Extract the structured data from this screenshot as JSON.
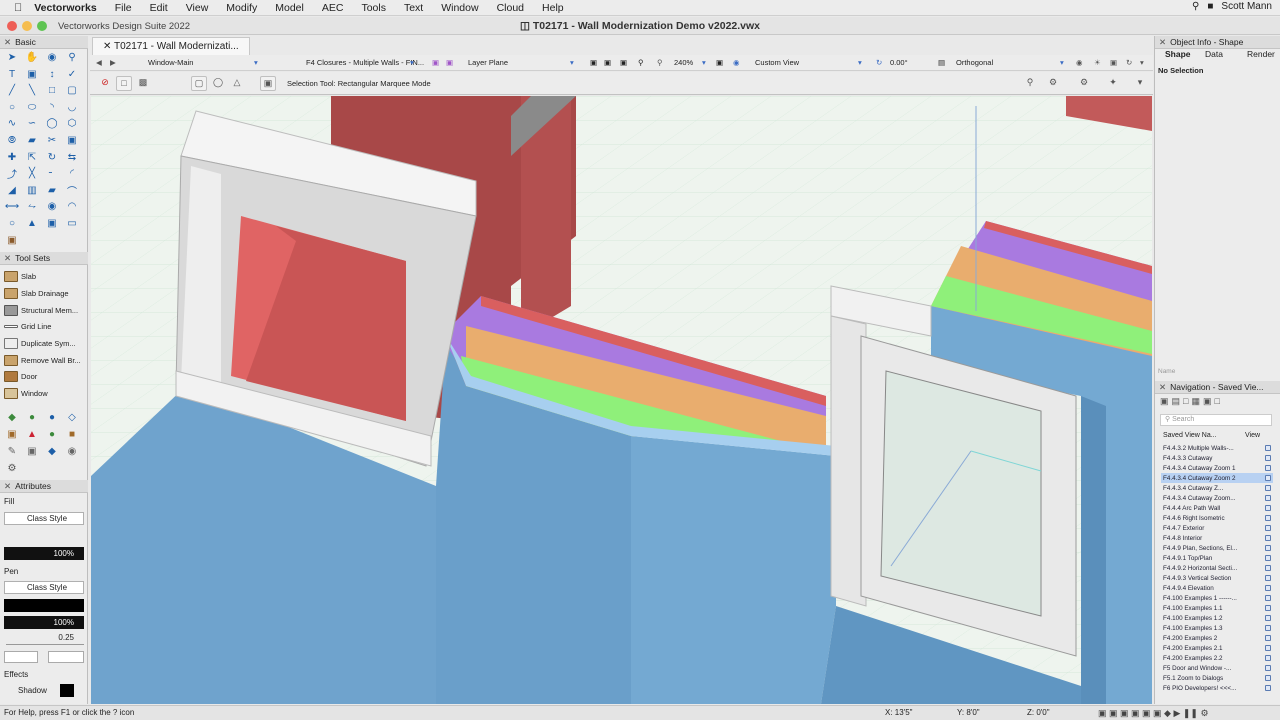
{
  "menubar": {
    "app": "Vectorworks",
    "items": [
      "File",
      "Edit",
      "View",
      "Modify",
      "Model",
      "AEC",
      "Tools",
      "Text",
      "Window",
      "Cloud",
      "Help"
    ],
    "user": "Scott Mann"
  },
  "titlebar": {
    "app_name": "Vectorworks Design Suite 2022",
    "document_title": "T02171 - Wall Modernization Demo v2022.vwx"
  },
  "doc_tab": {
    "label": "T02171 - Wall Modernizati..."
  },
  "view_bar": {
    "window": "Window-Main",
    "class": "F4 Closures - Multiple Walls - FIN...",
    "layer": "Layer Plane",
    "zoom": "240%",
    "view": "Custom View",
    "rotation": "0.00°",
    "projection": "Orthogonal"
  },
  "mode_bar": {
    "message": "Selection Tool: Rectangular Marquee Mode"
  },
  "palettes": {
    "basic": {
      "title": "Basic"
    },
    "tool_sets": {
      "title": "Tool Sets",
      "items": [
        "Slab",
        "Slab Drainage",
        "Structural Mem...",
        "Grid Line",
        "Duplicate Sym...",
        "Remove Wall Br...",
        "Door",
        "Window"
      ]
    },
    "attributes": {
      "title": "Attributes",
      "fill_label": "Fill",
      "fill_style": "Class Style",
      "fill_opacity": "100%",
      "pen_label": "Pen",
      "pen_style": "Class Style",
      "pen_opacity": "100%",
      "line_weight": "0.25",
      "effects_label": "Effects",
      "shadow_label": "Shadow"
    }
  },
  "object_info": {
    "title": "Object Info - Shape",
    "tabs": [
      "Shape",
      "Data",
      "Render"
    ],
    "status": "No Selection",
    "name_label": "Name"
  },
  "navigation": {
    "title": "Navigation - Saved Vie...",
    "search_placeholder": "Search",
    "col_name": "Saved View Na...",
    "col_view": "View",
    "selected_index": 3,
    "items": [
      "F4.4.3.2 Multiple Walls-...",
      "F4.4.3.3 Cutaway",
      "F4.4.3.4 Cutaway Zoom 1",
      "F4.4.3.4 Cutaway Zoom 2",
      "F4.4.3.4 Cutaway Z...",
      "F4.4.3.4 Cutaway Zoom...",
      "F4.4.4 Arc Path Wall",
      "F4.4.6 Right Isometric",
      "F4.4.7 Exterior",
      "F4.4.8 Interior",
      "F4.4.9 Plan, Sections, El...",
      "F4.4.9.1 Top/Plan",
      "F4.4.9.2 Horizontal Secti...",
      "F4.4.9.3 Vertical Section",
      "F4.4.9.4 Elevation",
      "F4.100 Examples 1 ------...",
      "F4.100 Examples 1.1",
      "F4.100 Examples 1.2",
      "F4.100 Examples 1.3",
      "F4.200 Examples 2",
      "F4.200 Examples 2.1",
      "F4.200 Examples 2.2",
      "F5 Door and Window -...",
      "F5.1 Zoom to Dialogs",
      "F6 PIO Developers! <<<..."
    ]
  },
  "status_bar": {
    "help": "For Help, press F1 or click the ? icon",
    "x": "X: 13'5\"",
    "y": "Y: 8'0\"",
    "z": "Z: 0'0\""
  },
  "colors": {
    "wall_blue": "#74a9d2",
    "wall_red": "#c25a5a",
    "layer_purple": "#a97ae0",
    "layer_orange": "#e9ad6e",
    "layer_green": "#8ff07a",
    "canvas_bg": "#eef4ee"
  }
}
